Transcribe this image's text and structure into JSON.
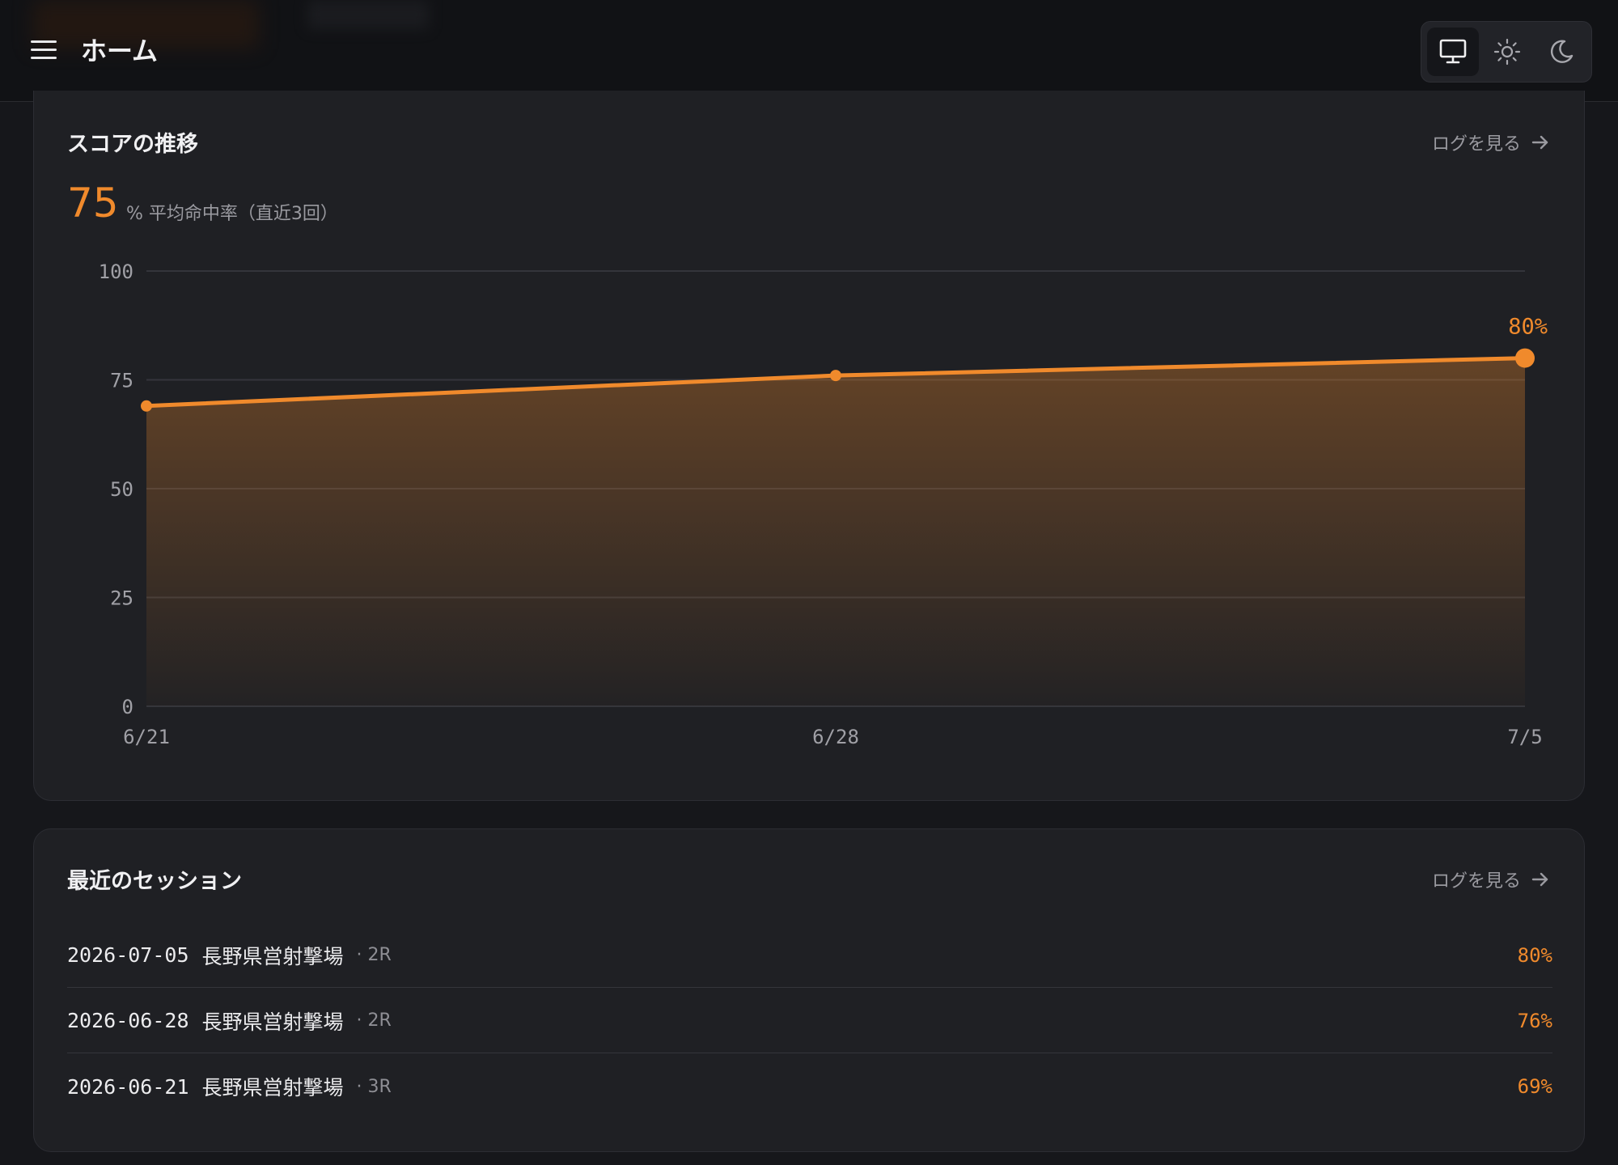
{
  "header": {
    "title": "ホーム",
    "theme_options": [
      "monitor-icon",
      "sun-icon",
      "moon-icon"
    ],
    "active_theme": "monitor-icon"
  },
  "score_card": {
    "title": "スコアの推移",
    "link_label": "ログを見る",
    "average_value": "75",
    "average_caption": "% 平均命中率（直近3回）"
  },
  "chart_data": {
    "type": "area",
    "x": [
      "6/21",
      "6/28",
      "7/5"
    ],
    "values": [
      69,
      76,
      80
    ],
    "ylim": [
      0,
      100
    ],
    "yticks": [
      "0",
      "25",
      "50",
      "75",
      "100"
    ],
    "last_label": "80%",
    "grid": true,
    "color": "#f08a2c"
  },
  "sessions_card": {
    "title": "最近のセッション",
    "link_label": "ログを見る",
    "rows": [
      {
        "date": "2026-07-05",
        "place": "長野県営射撃場",
        "rounds": "· 2R",
        "score": "80%"
      },
      {
        "date": "2026-06-28",
        "place": "長野県営射撃場",
        "rounds": "· 2R",
        "score": "76%"
      },
      {
        "date": "2026-06-21",
        "place": "長野県営射撃場",
        "rounds": "· 3R",
        "score": "69%"
      }
    ]
  },
  "colors": {
    "accent": "#f08a2c",
    "background": "#16171b",
    "card": "#1f2024"
  }
}
